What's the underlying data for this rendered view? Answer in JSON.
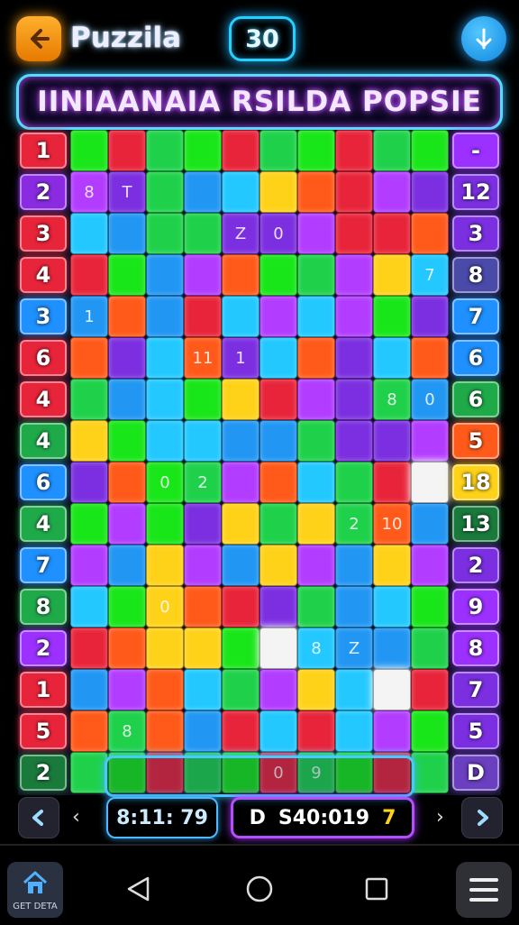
{
  "header": {
    "app_title": "Puzzila",
    "counter": "30",
    "back_icon": "back-arrow-icon",
    "action_icon": "swap-icon"
  },
  "banner": {
    "title": "IINIAANAIA RSILDA POPSIE"
  },
  "board": {
    "left_numbers": [
      "1",
      "2",
      "3",
      "4",
      "3",
      "6",
      "4",
      "4",
      "6",
      "4",
      "7",
      "8",
      "2",
      "1",
      "5",
      "2"
    ],
    "left_colors": [
      "#e8243a",
      "#8a2be2",
      "#e8243a",
      "#e8243a",
      "#1e90ff",
      "#e8243a",
      "#e8243a",
      "#1faa4a",
      "#1e90ff",
      "#1faa4a",
      "#1e90ff",
      "#1faa4a",
      "#9b30ff",
      "#e8243a",
      "#e8243a",
      "#1a7a3c"
    ],
    "right_numbers": [
      "-",
      "12",
      "3",
      "8",
      "7",
      "6",
      "6",
      "5",
      "18",
      "13",
      "2",
      "9",
      "8",
      "7",
      "5",
      "D"
    ],
    "right_colors": [
      "#9b30ff",
      "#7b2fe0",
      "#7b2fe0",
      "#4a4aa8",
      "#1e90ff",
      "#1e90ff",
      "#1faa4a",
      "#ff5a1a",
      "#ffd21a",
      "#1a7a3c",
      "#7b2fe0",
      "#9b30ff",
      "#9b30ff",
      "#7b2fe0",
      "#7b2fe0",
      "#6a3fc0"
    ],
    "piece_labels": [
      "T",
      "1",
      "0",
      "10",
      "Z",
      "9",
      "0",
      "1",
      "2",
      "0",
      "8",
      "8",
      "7",
      "8",
      "2",
      "8",
      "0",
      "Z",
      "11",
      "0"
    ],
    "palette": [
      "#19e619",
      "#2196f3",
      "#7b2fe0",
      "#e8243a",
      "#ffd21a",
      "#22c8ff",
      "#1fd14a",
      "#b23cff",
      "#ff5a1a"
    ]
  },
  "footer": {
    "left_glyph": "‹",
    "right_glyph": "›",
    "timer": "8:11: 79",
    "score_prefix": "D",
    "score": "S40:019",
    "score_suffix": "7",
    "prev_icon": "chevron-left-icon",
    "next_icon": "chevron-right-icon"
  },
  "system_nav": {
    "home_label": "GET DETA",
    "home_icon": "home-icon",
    "back_icon": "triangle-back-icon",
    "home_circle_icon": "circle-home-icon",
    "recents_icon": "square-recents-icon",
    "menu_icon": "hamburger-menu-icon"
  }
}
